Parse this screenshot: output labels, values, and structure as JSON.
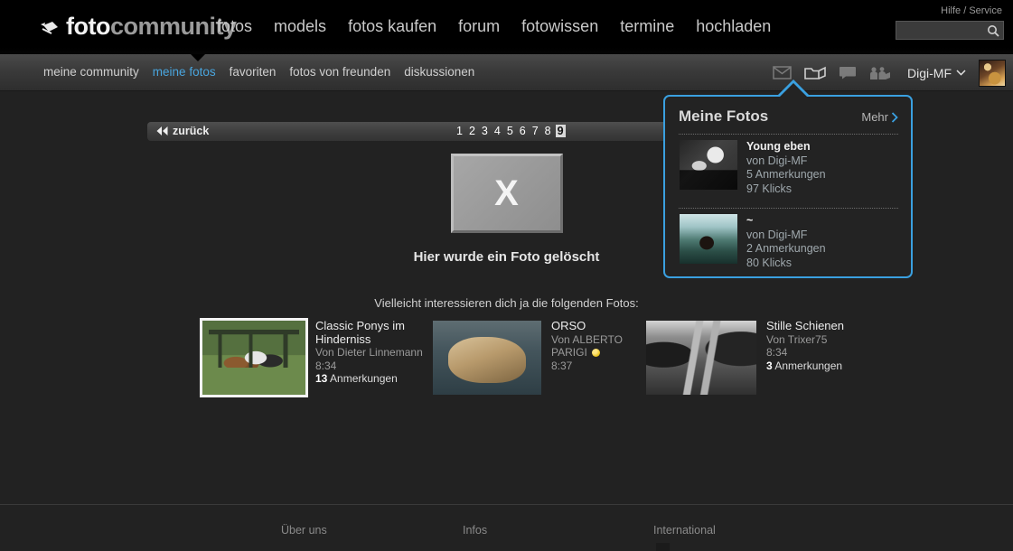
{
  "site": {
    "logo_foto": "foto",
    "logo_community": "community",
    "logo_icon": "camera-icon"
  },
  "header": {
    "help_link": "Hilfe / Service",
    "search": {
      "value": "",
      "placeholder": "",
      "icon": "search-icon"
    },
    "main_nav": [
      {
        "label": "fotos"
      },
      {
        "label": "models"
      },
      {
        "label": "fotos kaufen"
      },
      {
        "label": "forum"
      },
      {
        "label": "fotowissen"
      },
      {
        "label": "termine"
      },
      {
        "label": "hochladen"
      }
    ]
  },
  "subnav": {
    "items": [
      {
        "label": "meine community",
        "active": false
      },
      {
        "label": "meine fotos",
        "active": true
      },
      {
        "label": "favoriten",
        "active": false
      },
      {
        "label": "fotos von freunden",
        "active": false
      },
      {
        "label": "diskussionen",
        "active": false
      }
    ],
    "icons": [
      {
        "name": "mail-icon",
        "active": false
      },
      {
        "name": "photo-folder-icon",
        "active": true
      },
      {
        "name": "comment-bubble-icon",
        "active": false
      },
      {
        "name": "friends-icon",
        "active": false
      }
    ],
    "username": "Digi-MF",
    "username_caret": "chevron-down-icon",
    "avatar": "user-avatar"
  },
  "panel": {
    "title": "Meine Fotos",
    "more_label": "Mehr",
    "more_icon": "chevron-right-icon",
    "items": [
      {
        "title": "Young eben",
        "author": "von Digi-MF",
        "comments": "5 Anmerkungen",
        "clicks": "97 Klicks",
        "thumb": "young-eben-thumb"
      },
      {
        "title": "~",
        "author": "von Digi-MF",
        "comments": "2 Anmerkungen",
        "clicks": "80 Klicks",
        "thumb": "water-portrait-thumb"
      }
    ]
  },
  "pagination": {
    "back_label": "zurück",
    "back_icon": "double-arrow-left-icon",
    "pages": [
      "1",
      "2",
      "3",
      "4",
      "5",
      "6",
      "7",
      "8",
      "9"
    ],
    "current": "9"
  },
  "main": {
    "deleted_placeholder_glyph": "X",
    "deleted_message": "Hier wurde ein Foto gelöscht",
    "recommend_heading": "Vielleicht interessieren dich ja die folgenden Fotos:"
  },
  "recommendations": [
    {
      "title": "Classic Ponys im Hinderniss",
      "author": "Von Dieter Linnemann",
      "time": "8:34",
      "comments_count": "13",
      "comments_label": "Anmerkungen",
      "badge": false,
      "thumb": "classic-ponys-thumb"
    },
    {
      "title": "ORSO",
      "author": "Von ALBERTO PARIGI",
      "time": "8:37",
      "comments_count": "",
      "comments_label": "",
      "badge": true,
      "thumb": "orso-bear-thumb"
    },
    {
      "title": "Stille Schienen",
      "author": "Von Trixer75",
      "time": "8:34",
      "comments_count": "3",
      "comments_label": "Anmerkungen",
      "badge": false,
      "thumb": "stille-schienen-thumb"
    }
  ],
  "footer": {
    "columns": [
      {
        "label": "Über uns"
      },
      {
        "label": "Infos"
      },
      {
        "label": "International"
      }
    ]
  },
  "colors": {
    "accent_blue": "#3aa0e0",
    "nav_active": "#49a5de",
    "page_bg": "#222222",
    "badge_yellow": "#e8c219"
  }
}
